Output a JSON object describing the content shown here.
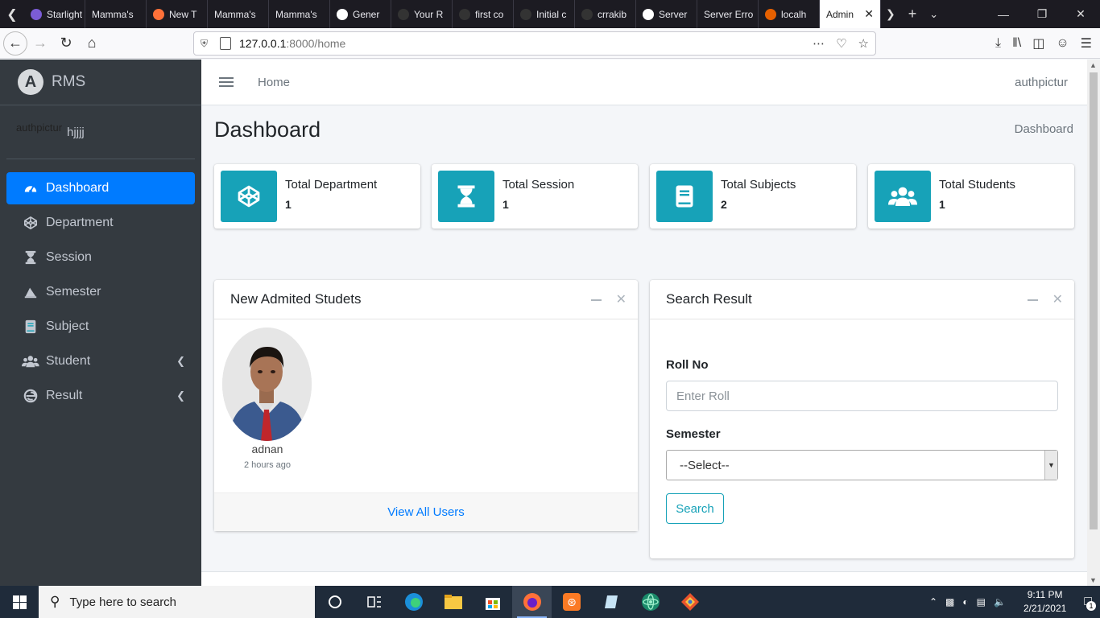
{
  "browser": {
    "tabs": [
      {
        "title": "Starlight R",
        "color": "#7b5cd6"
      },
      {
        "title": "Mamma's",
        "color": ""
      },
      {
        "title": "New T",
        "color": "#ff7139"
      },
      {
        "title": "Mamma's",
        "color": ""
      },
      {
        "title": "Mamma's",
        "color": ""
      },
      {
        "title": "Gener",
        "color": "#ffffff"
      },
      {
        "title": "Your R",
        "color": "#333333"
      },
      {
        "title": "first co",
        "color": "#333333"
      },
      {
        "title": "Initial c",
        "color": "#333333"
      },
      {
        "title": "crrakib",
        "color": "#333333"
      },
      {
        "title": "Server",
        "color": "#ffffff"
      },
      {
        "title": "Server Erro",
        "color": ""
      },
      {
        "title": "localh",
        "color": "#e66000"
      }
    ],
    "active_tab": "Admin",
    "url_host": "127.0.0.1",
    "url_path": ":8000/home"
  },
  "app": {
    "brand": "RMS",
    "user_img_alt": "authpictur",
    "user_name": "hjjjj",
    "menu": [
      {
        "label": "Dashboard",
        "icon": "tachometer-icon",
        "active": true,
        "arrow": false
      },
      {
        "label": "Department",
        "icon": "codepen-icon",
        "active": false,
        "arrow": false
      },
      {
        "label": "Session",
        "icon": "hourglass-icon",
        "active": false,
        "arrow": false
      },
      {
        "label": "Semester",
        "icon": "signature-icon",
        "active": false,
        "arrow": false
      },
      {
        "label": "Subject",
        "icon": "book-icon",
        "active": false,
        "arrow": false
      },
      {
        "label": "Student",
        "icon": "users-icon",
        "active": false,
        "arrow": true
      },
      {
        "label": "Result",
        "icon": "edge-icon",
        "active": false,
        "arrow": true
      }
    ],
    "top_home": "Home",
    "top_user": "authpictur"
  },
  "page": {
    "title": "Dashboard",
    "breadcrumb": "Dashboard"
  },
  "info_boxes": [
    {
      "label": "Total Department",
      "value": "1",
      "icon": "codepen-icon"
    },
    {
      "label": "Total Session",
      "value": "1",
      "icon": "hourglass-icon"
    },
    {
      "label": "Total Subjects",
      "value": "2",
      "icon": "book-icon"
    },
    {
      "label": "Total Students",
      "value": "1",
      "icon": "users-icon"
    }
  ],
  "students_card": {
    "title": "New Admited Studets",
    "student_name": "adnan",
    "student_time": "2 hours ago",
    "footer": "View All Users"
  },
  "search_card": {
    "title": "Search Result",
    "roll_label": "Roll No",
    "roll_placeholder": "Enter Roll",
    "semester_label": "Semester",
    "semester_selected": "--Select--",
    "button": "Search"
  },
  "taskbar": {
    "search_placeholder": "Type here to search",
    "time": "9:11 PM",
    "date": "2/21/2021",
    "notifications": "1"
  }
}
